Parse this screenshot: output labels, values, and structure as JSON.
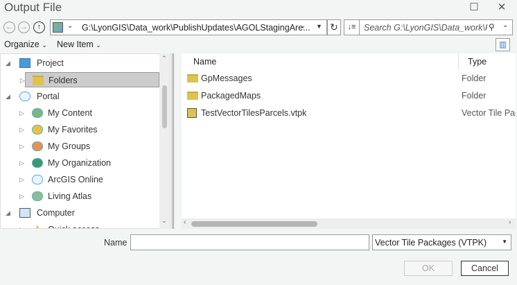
{
  "title": "Output File",
  "nav": {
    "address": "G:\\LyonGIS\\Data_work\\PublishUpdates\\AGOLStagingAre...",
    "search_placeholder": "Search G:\\LyonGIS\\Data_work\\Pu"
  },
  "toolbar": {
    "organize": "Organize",
    "new_item": "New Item"
  },
  "tree": [
    {
      "label": "Project",
      "level": 0,
      "expanded": true,
      "icon": "project-icon"
    },
    {
      "label": "Folders",
      "level": 1,
      "selected": true,
      "icon": "folder-icon"
    },
    {
      "label": "Portal",
      "level": 0,
      "expanded": true,
      "icon": "cloud-icon"
    },
    {
      "label": "My Content",
      "level": 1,
      "icon": "my-content-icon"
    },
    {
      "label": "My Favorites",
      "level": 1,
      "icon": "favorites-icon"
    },
    {
      "label": "My Groups",
      "level": 1,
      "icon": "groups-icon"
    },
    {
      "label": "My Organization",
      "level": 1,
      "icon": "organization-icon"
    },
    {
      "label": "ArcGIS Online",
      "level": 1,
      "icon": "cloud-icon"
    },
    {
      "label": "Living Atlas",
      "level": 1,
      "icon": "living-atlas-icon"
    },
    {
      "label": "Computer",
      "level": 0,
      "expanded": true,
      "icon": "computer-icon"
    },
    {
      "label": "Quick access",
      "level": 1,
      "icon": "star-icon"
    }
  ],
  "list": {
    "columns": [
      "Name",
      "Type"
    ],
    "rows": [
      {
        "name": "GpMessages",
        "type": "Folder",
        "icon": "folder-icon"
      },
      {
        "name": "PackagedMaps",
        "type": "Folder",
        "icon": "folder-icon"
      },
      {
        "name": "TestVectorTilesParcels.vtpk",
        "type": "Vector Tile Package",
        "icon": "vtpk-icon"
      }
    ]
  },
  "footer": {
    "name_label": "Name",
    "name_value": "",
    "file_type": "Vector Tile Packages (VTPK)",
    "ok": "OK",
    "cancel": "Cancel"
  }
}
